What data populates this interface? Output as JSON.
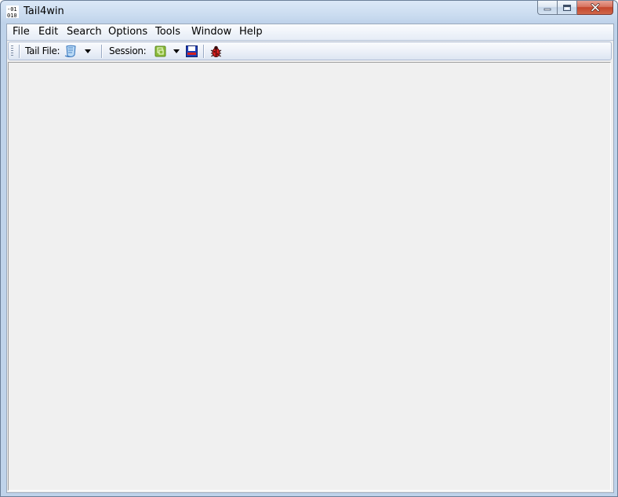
{
  "window": {
    "title": "Tail4win",
    "app_icon": "binary-010-icon",
    "caption_buttons": [
      "minimize-icon",
      "maximize-icon",
      "close-icon"
    ]
  },
  "menu": {
    "items": [
      {
        "label": "File"
      },
      {
        "label": "Edit"
      },
      {
        "label": "Search"
      },
      {
        "label": "Options"
      },
      {
        "label": "Tools"
      },
      {
        "label": "Window"
      },
      {
        "label": "Help"
      }
    ]
  },
  "toolbar": {
    "tail_file_label": "Tail File:",
    "tail_file_icon": "open-file-icon",
    "session_label": "Session:",
    "session_icon": "session-load-icon",
    "save_icon": "save-icon",
    "bug_icon": "bug-icon"
  },
  "colors": {
    "accent_close": "#c4452c",
    "session_icon_green": "#8bbb3a",
    "save_icon_blue": "#1f3fb4",
    "bug_icon_red": "#d22020"
  }
}
